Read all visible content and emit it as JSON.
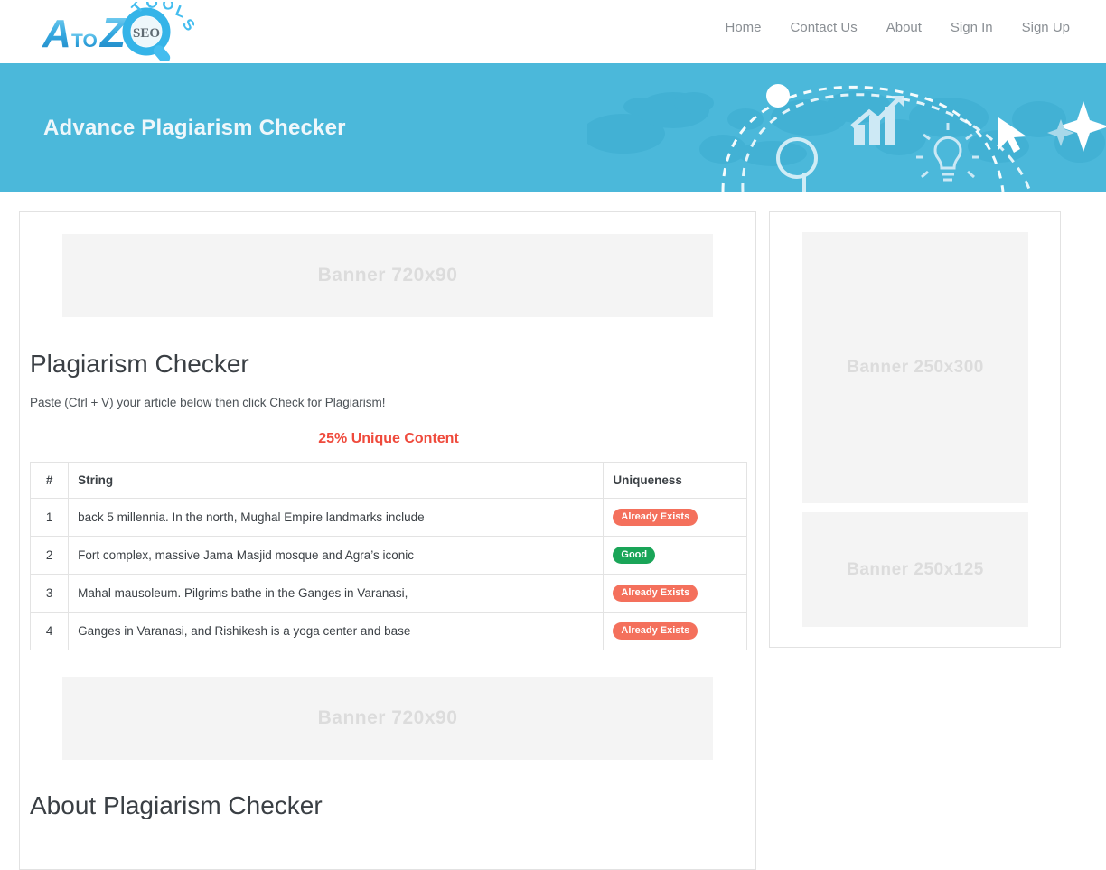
{
  "header": {
    "logo": {
      "alt": "A to Z SEO Tools",
      "text_a": "A",
      "text_to": "TO",
      "text_z": "Z",
      "text_seo": "SEO",
      "text_tools": "TOOLS"
    },
    "nav": [
      {
        "label": "Home",
        "name": "nav-home"
      },
      {
        "label": "Contact Us",
        "name": "nav-contact-us"
      },
      {
        "label": "About",
        "name": "nav-about"
      },
      {
        "label": "Sign In",
        "name": "nav-sign-in"
      },
      {
        "label": "Sign Up",
        "name": "nav-sign-up"
      }
    ]
  },
  "hero": {
    "title": "Advance Plagiarism Checker",
    "background_color": "#4bb8da"
  },
  "ads": {
    "top_banner": "Banner  720x90",
    "bottom_banner": "Banner  720x90",
    "side_banner_large": "Banner  250x300",
    "side_banner_small": "Banner  250x125"
  },
  "tool": {
    "title": "Plagiarism Checker",
    "instruction": "Paste (Ctrl + V) your article below then click Check for Plagiarism!",
    "unique_score": "25% Unique Content",
    "unique_score_color": "#ef4a3c"
  },
  "results": {
    "columns": [
      "#",
      "String",
      "Uniqueness"
    ],
    "rows": [
      {
        "index": "1",
        "string": "back 5 millennia. In the north, Mughal Empire landmarks include",
        "uniqueness": "Already Exists",
        "status": "exists"
      },
      {
        "index": "2",
        "string": "Fort complex, massive Jama Masjid mosque and Agra’s iconic",
        "uniqueness": "Good",
        "status": "good"
      },
      {
        "index": "3",
        "string": "Mahal mausoleum. Pilgrims bathe in the Ganges in Varanasi,",
        "uniqueness": "Already Exists",
        "status": "exists"
      },
      {
        "index": "4",
        "string": "Ganges in Varanasi, and Rishikesh is a yoga center and base",
        "uniqueness": "Already Exists",
        "status": "exists"
      }
    ],
    "badge_colors": {
      "exists": "#f4705c",
      "good": "#1aa558"
    }
  },
  "about": {
    "title": "About Plagiarism Checker"
  }
}
